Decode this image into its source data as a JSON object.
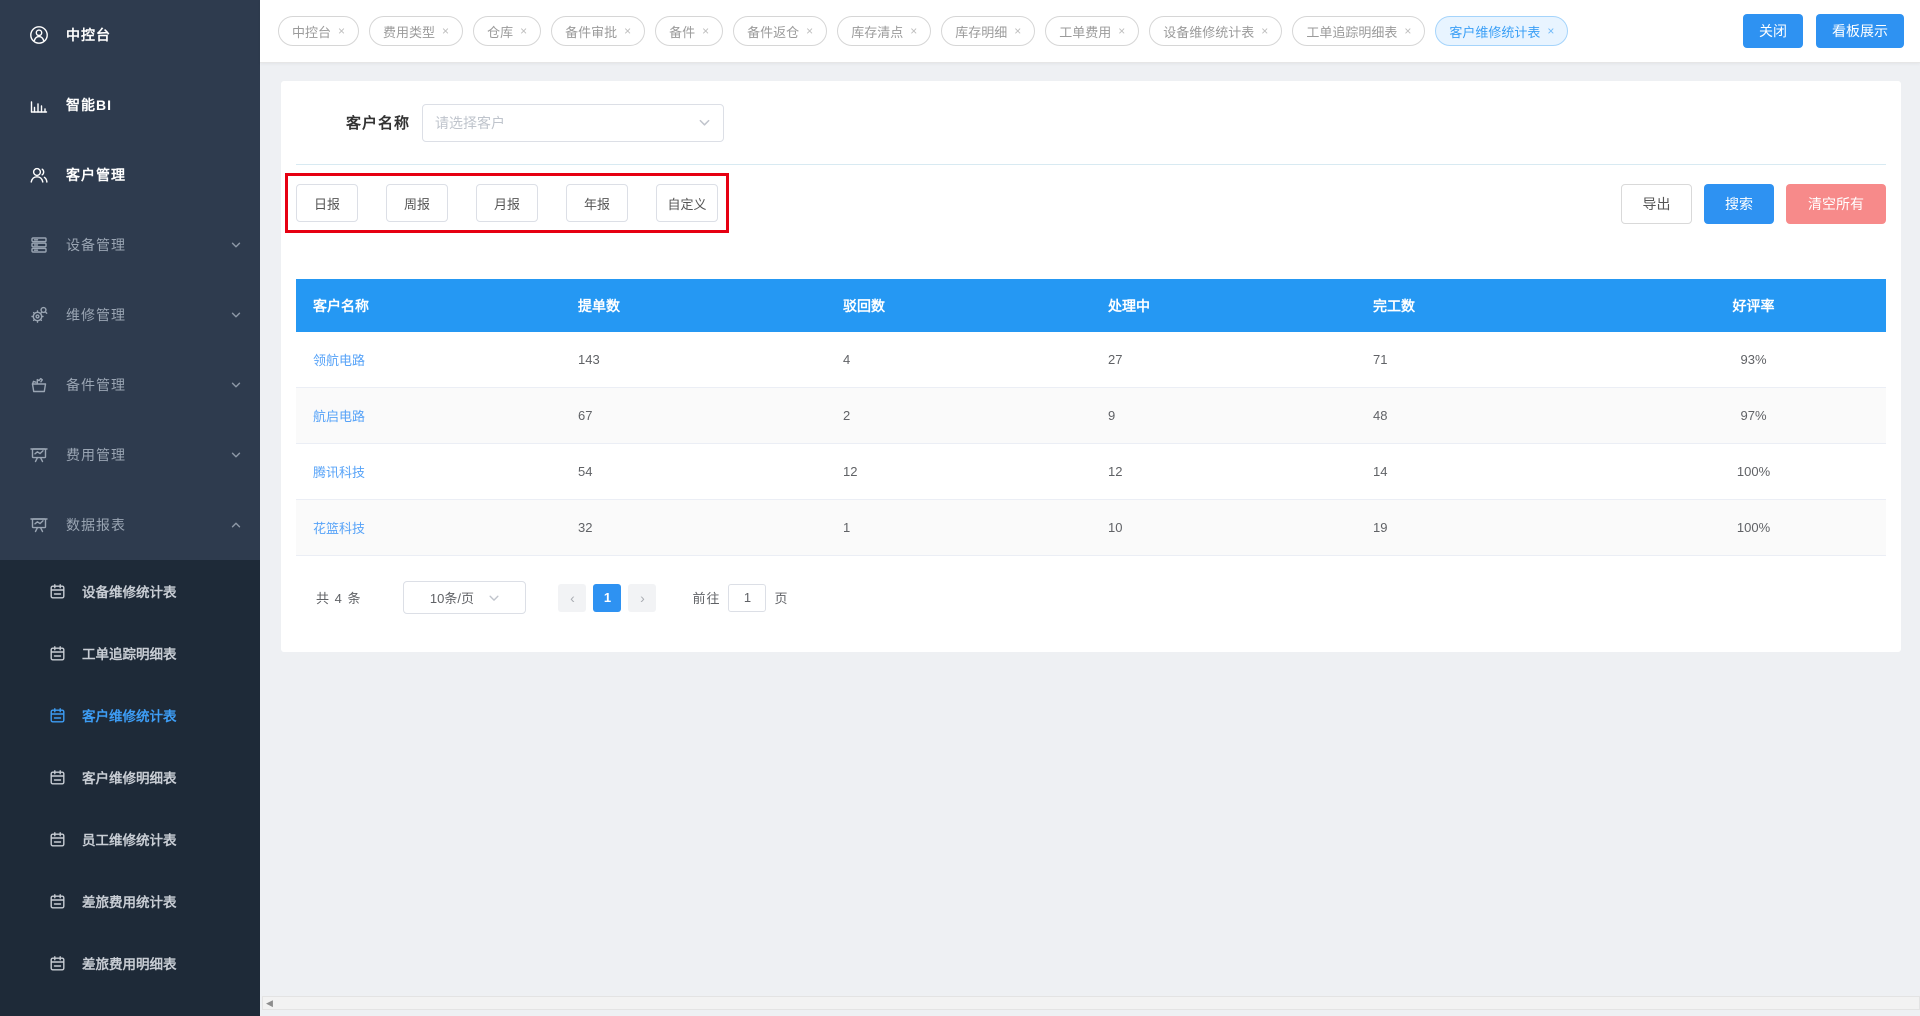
{
  "sidebar": {
    "items": [
      {
        "label": "中控台",
        "icon": "console",
        "bright": true,
        "chevron": null
      },
      {
        "label": "智能BI",
        "icon": "bi-chart",
        "bright": true,
        "chevron": null
      },
      {
        "label": "客户管理",
        "icon": "customers",
        "bright": true,
        "chevron": null
      },
      {
        "label": "设备管理",
        "icon": "devices",
        "bright": false,
        "chevron": "down"
      },
      {
        "label": "维修管理",
        "icon": "repair",
        "bright": false,
        "chevron": "down"
      },
      {
        "label": "备件管理",
        "icon": "toolbox",
        "bright": false,
        "chevron": "down"
      },
      {
        "label": "费用管理",
        "icon": "board",
        "bright": false,
        "chevron": "down"
      },
      {
        "label": "数据报表",
        "icon": "board",
        "bright": false,
        "chevron": "up"
      }
    ],
    "submenu": [
      {
        "label": "设备维修统计表",
        "active": false
      },
      {
        "label": "工单追踪明细表",
        "active": false
      },
      {
        "label": "客户维修统计表",
        "active": true
      },
      {
        "label": "客户维修明细表",
        "active": false
      },
      {
        "label": "员工维修统计表",
        "active": false
      },
      {
        "label": "差旅费用统计表",
        "active": false
      },
      {
        "label": "差旅费用明细表",
        "active": false
      }
    ]
  },
  "tabbar": {
    "tabs": [
      {
        "label": "中控台",
        "active": false
      },
      {
        "label": "费用类型",
        "active": false
      },
      {
        "label": "仓库",
        "active": false
      },
      {
        "label": "备件审批",
        "active": false
      },
      {
        "label": "备件",
        "active": false
      },
      {
        "label": "备件返仓",
        "active": false
      },
      {
        "label": "库存清点",
        "active": false
      },
      {
        "label": "库存明细",
        "active": false
      },
      {
        "label": "工单费用",
        "active": false
      },
      {
        "label": "设备维修统计表",
        "active": false
      },
      {
        "label": "工单追踪明细表",
        "active": false
      },
      {
        "label": "客户维修统计表",
        "active": true
      }
    ],
    "close_glyph": "×",
    "close_label": "关闭",
    "board_label": "看板展示"
  },
  "filters": {
    "customer_label": "客户名称",
    "customer_placeholder": "请选择客户",
    "period_buttons": [
      "日报",
      "周报",
      "月报",
      "年报",
      "自定义"
    ],
    "export_label": "导出",
    "search_label": "搜索",
    "clear_label": "清空所有"
  },
  "table": {
    "headers": [
      "客户名称",
      "提单数",
      "驳回数",
      "处理中",
      "完工数",
      "好评率"
    ],
    "rows": [
      {
        "customer": "领航电路",
        "submitted": "143",
        "rejected": "4",
        "processing": "27",
        "completed": "71",
        "rating": "93%"
      },
      {
        "customer": "航启电路",
        "submitted": "67",
        "rejected": "2",
        "processing": "9",
        "completed": "48",
        "rating": "97%"
      },
      {
        "customer": "腾讯科技",
        "submitted": "54",
        "rejected": "12",
        "processing": "12",
        "completed": "14",
        "rating": "100%"
      },
      {
        "customer": "花篮科技",
        "submitted": "32",
        "rejected": "1",
        "processing": "10",
        "completed": "19",
        "rating": "100%"
      }
    ]
  },
  "pagination": {
    "total": "共 4 条",
    "page_size": "10条/页",
    "prev_glyph": "‹",
    "next_glyph": "›",
    "current_page": "1",
    "goto_label": "前往",
    "goto_value": "1",
    "page_unit": "页"
  },
  "colors": {
    "primary_blue": "#2e92f2",
    "table_header_blue": "#2598f3",
    "active_tab_bg": "#e8f4ff",
    "active_tab_text": "#3a9ff6",
    "clear_button_red": "#f78a8a",
    "annotation_red": "#e60012",
    "sidebar_bg": "#2e3b4e",
    "submenu_bg": "#1e2a38",
    "link_blue": "#57a3f8"
  }
}
